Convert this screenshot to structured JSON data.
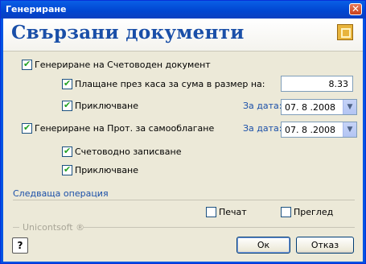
{
  "window": {
    "title": "Генериране",
    "close_glyph": "✕"
  },
  "header": {
    "heading": "Свързани документи",
    "logo_icon": "app-logo-icon"
  },
  "options": {
    "accounting_doc": {
      "label": "Генериране на Счетоводен документ",
      "checked": true
    },
    "cash_payment": {
      "label": "Плащане през каса за сума в размер на:",
      "checked": true,
      "amount": "8.33"
    },
    "close1": {
      "label": "Приключване",
      "checked": true,
      "date_label": "За дата:",
      "date": "07. 8 .2008"
    },
    "self_tax": {
      "label": "Генериране на Прот. за самооблагане",
      "checked": true,
      "date_label": "За дата:",
      "date": "07. 8 .2008"
    },
    "accounting_entry": {
      "label": "Счетоводно записване",
      "checked": true
    },
    "close2": {
      "label": "Приключване",
      "checked": true
    }
  },
  "next_operation": {
    "label": "Следваща операция"
  },
  "print": {
    "label": "Печат",
    "checked": false
  },
  "preview": {
    "label": "Преглед",
    "checked": false
  },
  "brand": {
    "text": "Unicontsoft ®"
  },
  "buttons": {
    "ok": "Ок",
    "cancel": "Отказ",
    "help": "?"
  },
  "colors": {
    "accent": "#1a4fa8",
    "titlebar": "#0054e3",
    "dialog_bg": "#ece9d8"
  }
}
